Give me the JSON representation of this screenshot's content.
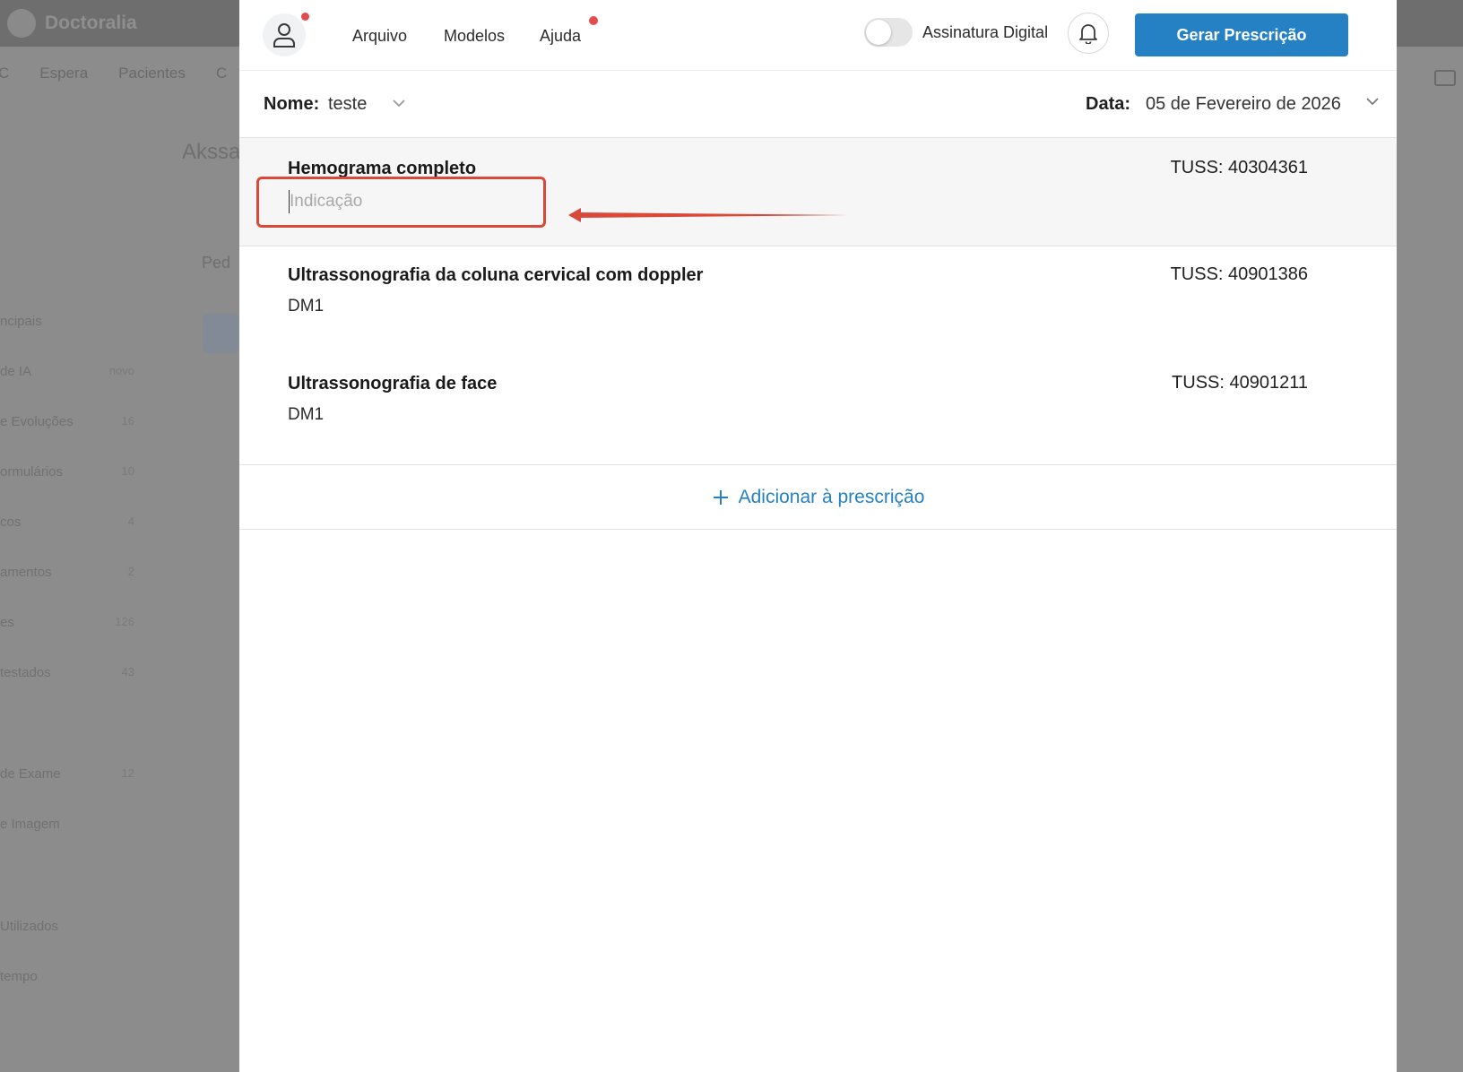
{
  "background": {
    "brand": "Doctoralia",
    "nav": [
      "C",
      "Espera",
      "Pacientes",
      "C"
    ],
    "patient_name_fragment": "Akssa",
    "ped_fragment": "Ped",
    "side_items": [
      {
        "label": "ncipais",
        "count": ""
      },
      {
        "label": "de IA",
        "count": "novo"
      },
      {
        "label": "e Evoluções",
        "count": "16"
      },
      {
        "label": "ormulários",
        "count": "10"
      },
      {
        "label": "cos",
        "count": "4"
      },
      {
        "label": "amentos",
        "count": "2"
      },
      {
        "label": "es",
        "count": "126"
      },
      {
        "label": "testados",
        "count": "43"
      },
      {
        "label": "de Exame",
        "count": "12"
      },
      {
        "label": "e Imagem",
        "count": ""
      },
      {
        "label": "Utilizados",
        "count": ""
      },
      {
        "label": "tempo",
        "count": ""
      }
    ]
  },
  "header": {
    "menu": {
      "arquivo": "Arquivo",
      "modelos": "Modelos",
      "ajuda": "Ajuda"
    },
    "toggle_label": "Assinatura Digital",
    "primary_button": "Gerar Prescrição"
  },
  "subheader": {
    "nome_label": "Nome:",
    "nome_value": "teste",
    "data_label": "Data:",
    "data_value": "05 de Fevereiro de 2026"
  },
  "items": [
    {
      "title": "Hemograma completo",
      "tuss": "TUSS: 40304361",
      "indicacao_value": "",
      "indicacao_placeholder": "Indicação"
    },
    {
      "title": "Ultrassonografia da coluna cervical com doppler",
      "tuss": "TUSS: 40901386",
      "indicacao": "DM1"
    },
    {
      "title": "Ultrassonografia de face",
      "tuss": "TUSS: 40901211",
      "indicacao": "DM1"
    }
  ],
  "add_button_label": "Adicionar à prescrição",
  "colors": {
    "accent": "#2581c4",
    "highlight": "#d9493a",
    "notification_dot": "#e24c4c"
  }
}
